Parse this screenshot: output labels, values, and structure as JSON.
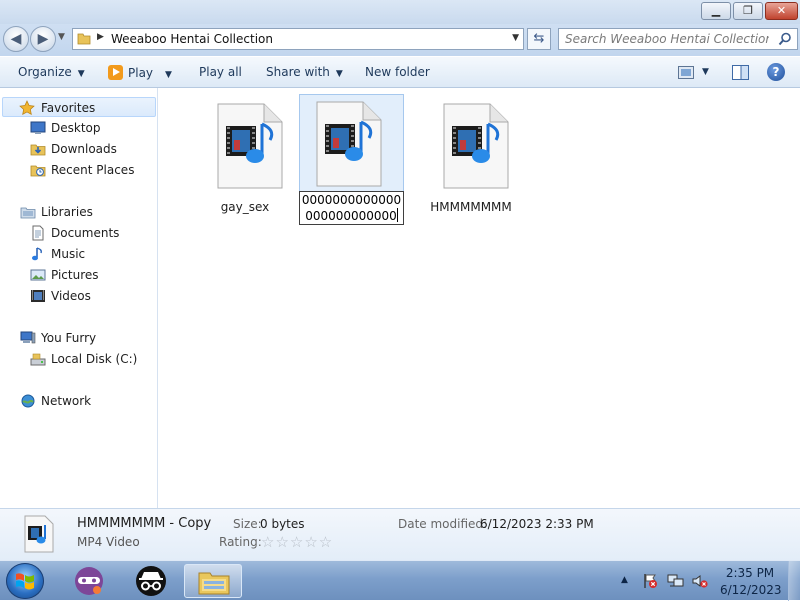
{
  "window": {
    "minimize_glyph": "▁",
    "maximize_glyph": "❐",
    "close_glyph": "✕"
  },
  "address": {
    "path": "Weeaboo Hentai Collection",
    "search_placeholder": "Search Weeaboo Hentai Collection"
  },
  "toolbar": {
    "organize": "Organize",
    "play": "Play",
    "play_all": "Play all",
    "share_with": "Share with",
    "new_folder": "New folder"
  },
  "nav": {
    "favorites": "Favorites",
    "favorites_items": [
      "Desktop",
      "Downloads",
      "Recent Places"
    ],
    "libraries": "Libraries",
    "libraries_items": [
      "Documents",
      "Music",
      "Pictures",
      "Videos"
    ],
    "computer": "You Furry",
    "computer_items": [
      "Local Disk (C:)"
    ],
    "network": "Network"
  },
  "files": [
    {
      "name": "gay_sex",
      "icon": "video-file-icon"
    },
    {
      "name": "0000000000000000000000000",
      "icon": "video-file-icon",
      "state": "renaming"
    },
    {
      "name": "HMMMMMMM",
      "icon": "video-file-icon"
    }
  ],
  "details": {
    "name": "HMMMMMMM - Copy",
    "type": "MP4 Video",
    "size_label": "Size:",
    "size_value": "0 bytes",
    "rating_label": "Rating:",
    "rating_stars": "☆☆☆☆☆",
    "rating_value": 0,
    "modified_label": "Date modified:",
    "modified_value": "6/12/2023 2:33 PM"
  },
  "taskbar": {
    "time": "2:35 PM",
    "date": "6/12/2023",
    "apps": [
      "tor-browser-icon",
      "incognito-icon",
      "windows-explorer-icon"
    ]
  },
  "colors": {
    "selection": "#e2eefb",
    "toolbar_text": "#1e395b",
    "taskbar": "#7d9fcb"
  }
}
